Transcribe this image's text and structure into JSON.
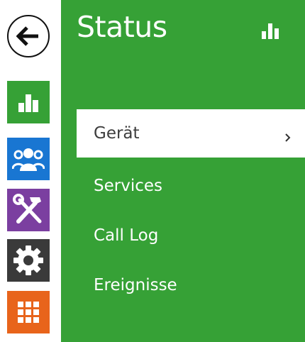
{
  "colors": {
    "accent_green": "#36a136",
    "directory_blue": "#1976d2",
    "services_purple": "#7b3fa0",
    "settings_gray": "#3a3a3a",
    "apps_orange": "#e8641b"
  },
  "rail": {
    "items": [
      {
        "id": "status",
        "icon": "bar-chart-icon"
      },
      {
        "id": "directory",
        "icon": "users-icon"
      },
      {
        "id": "services",
        "icon": "tools-icon"
      },
      {
        "id": "settings",
        "icon": "gear-icon"
      },
      {
        "id": "apps",
        "icon": "grid-icon"
      }
    ],
    "back_icon": "arrow-left-icon"
  },
  "panel": {
    "title": "Status",
    "title_icon": "bar-chart-icon",
    "menu": [
      {
        "label": "Gerät",
        "active": true,
        "icon": "chevron-right-icon"
      },
      {
        "label": "Services",
        "active": false
      },
      {
        "label": "Call Log",
        "active": false
      },
      {
        "label": "Ereignisse",
        "active": false
      }
    ]
  }
}
